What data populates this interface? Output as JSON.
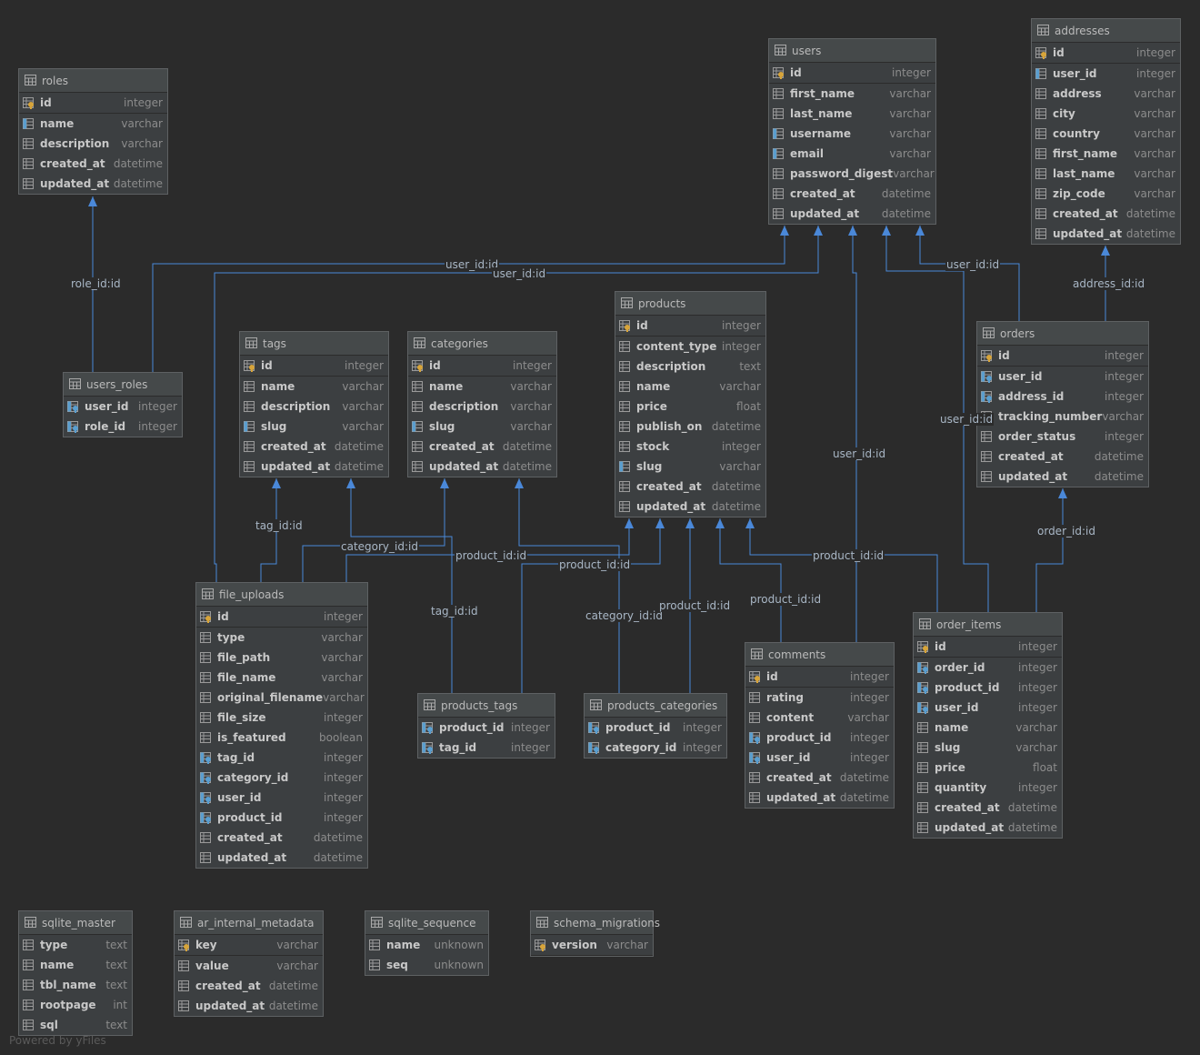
{
  "footer": "Powered by yFiles",
  "colors": {
    "background": "#2b2b2b",
    "table": "#3c3f41",
    "edge": "#4a88d8",
    "key": "#d7a43a",
    "fk": "#5a9ecf"
  },
  "tables": [
    {
      "id": "roles",
      "name": "roles",
      "columns": [
        {
          "name": "id",
          "type": "integer",
          "kind": "pk"
        },
        {
          "name": "name",
          "type": "varchar",
          "kind": "idx"
        },
        {
          "name": "description",
          "type": "varchar",
          "kind": "col"
        },
        {
          "name": "created_at",
          "type": "datetime",
          "kind": "col"
        },
        {
          "name": "updated_at",
          "type": "datetime",
          "kind": "col"
        }
      ]
    },
    {
      "id": "users",
      "name": "users",
      "columns": [
        {
          "name": "id",
          "type": "integer",
          "kind": "pk"
        },
        {
          "name": "first_name",
          "type": "varchar",
          "kind": "col"
        },
        {
          "name": "last_name",
          "type": "varchar",
          "kind": "col"
        },
        {
          "name": "username",
          "type": "varchar",
          "kind": "idx"
        },
        {
          "name": "email",
          "type": "varchar",
          "kind": "idx"
        },
        {
          "name": "password_digest",
          "type": "varchar",
          "kind": "col"
        },
        {
          "name": "created_at",
          "type": "datetime",
          "kind": "col"
        },
        {
          "name": "updated_at",
          "type": "datetime",
          "kind": "col"
        }
      ]
    },
    {
      "id": "addresses",
      "name": "addresses",
      "columns": [
        {
          "name": "id",
          "type": "integer",
          "kind": "pk"
        },
        {
          "name": "user_id",
          "type": "integer",
          "kind": "idx"
        },
        {
          "name": "address",
          "type": "varchar",
          "kind": "col"
        },
        {
          "name": "city",
          "type": "varchar",
          "kind": "col"
        },
        {
          "name": "country",
          "type": "varchar",
          "kind": "col"
        },
        {
          "name": "first_name",
          "type": "varchar",
          "kind": "col"
        },
        {
          "name": "last_name",
          "type": "varchar",
          "kind": "col"
        },
        {
          "name": "zip_code",
          "type": "varchar",
          "kind": "col"
        },
        {
          "name": "created_at",
          "type": "datetime",
          "kind": "col"
        },
        {
          "name": "updated_at",
          "type": "datetime",
          "kind": "col"
        }
      ]
    },
    {
      "id": "users_roles",
      "name": "users_roles",
      "columns": [
        {
          "name": "user_id",
          "type": "integer",
          "kind": "fk"
        },
        {
          "name": "role_id",
          "type": "integer",
          "kind": "fk"
        }
      ]
    },
    {
      "id": "tags",
      "name": "tags",
      "columns": [
        {
          "name": "id",
          "type": "integer",
          "kind": "pk"
        },
        {
          "name": "name",
          "type": "varchar",
          "kind": "col"
        },
        {
          "name": "description",
          "type": "varchar",
          "kind": "col"
        },
        {
          "name": "slug",
          "type": "varchar",
          "kind": "idx"
        },
        {
          "name": "created_at",
          "type": "datetime",
          "kind": "col"
        },
        {
          "name": "updated_at",
          "type": "datetime",
          "kind": "col"
        }
      ]
    },
    {
      "id": "categories",
      "name": "categories",
      "columns": [
        {
          "name": "id",
          "type": "integer",
          "kind": "pk"
        },
        {
          "name": "name",
          "type": "varchar",
          "kind": "col"
        },
        {
          "name": "description",
          "type": "varchar",
          "kind": "col"
        },
        {
          "name": "slug",
          "type": "varchar",
          "kind": "idx"
        },
        {
          "name": "created_at",
          "type": "datetime",
          "kind": "col"
        },
        {
          "name": "updated_at",
          "type": "datetime",
          "kind": "col"
        }
      ]
    },
    {
      "id": "products",
      "name": "products",
      "columns": [
        {
          "name": "id",
          "type": "integer",
          "kind": "pk"
        },
        {
          "name": "content_type",
          "type": "integer",
          "kind": "col"
        },
        {
          "name": "description",
          "type": "text",
          "kind": "col"
        },
        {
          "name": "name",
          "type": "varchar",
          "kind": "col"
        },
        {
          "name": "price",
          "type": "float",
          "kind": "col"
        },
        {
          "name": "publish_on",
          "type": "datetime",
          "kind": "col"
        },
        {
          "name": "stock",
          "type": "integer",
          "kind": "col"
        },
        {
          "name": "slug",
          "type": "varchar",
          "kind": "idx"
        },
        {
          "name": "created_at",
          "type": "datetime",
          "kind": "col"
        },
        {
          "name": "updated_at",
          "type": "datetime",
          "kind": "col"
        }
      ]
    },
    {
      "id": "orders",
      "name": "orders",
      "columns": [
        {
          "name": "id",
          "type": "integer",
          "kind": "pk"
        },
        {
          "name": "user_id",
          "type": "integer",
          "kind": "fk"
        },
        {
          "name": "address_id",
          "type": "integer",
          "kind": "fk"
        },
        {
          "name": "tracking_number",
          "type": "varchar",
          "kind": "col"
        },
        {
          "name": "order_status",
          "type": "integer",
          "kind": "col"
        },
        {
          "name": "created_at",
          "type": "datetime",
          "kind": "col"
        },
        {
          "name": "updated_at",
          "type": "datetime",
          "kind": "col"
        }
      ]
    },
    {
      "id": "file_uploads",
      "name": "file_uploads",
      "columns": [
        {
          "name": "id",
          "type": "integer",
          "kind": "pk"
        },
        {
          "name": "type",
          "type": "varchar",
          "kind": "col"
        },
        {
          "name": "file_path",
          "type": "varchar",
          "kind": "col"
        },
        {
          "name": "file_name",
          "type": "varchar",
          "kind": "col"
        },
        {
          "name": "original_filename",
          "type": "varchar",
          "kind": "col"
        },
        {
          "name": "file_size",
          "type": "integer",
          "kind": "col"
        },
        {
          "name": "is_featured",
          "type": "boolean",
          "kind": "col"
        },
        {
          "name": "tag_id",
          "type": "integer",
          "kind": "fk"
        },
        {
          "name": "category_id",
          "type": "integer",
          "kind": "fk"
        },
        {
          "name": "user_id",
          "type": "integer",
          "kind": "fk"
        },
        {
          "name": "product_id",
          "type": "integer",
          "kind": "fk"
        },
        {
          "name": "created_at",
          "type": "datetime",
          "kind": "col"
        },
        {
          "name": "updated_at",
          "type": "datetime",
          "kind": "col"
        }
      ]
    },
    {
      "id": "products_tags",
      "name": "products_tags",
      "columns": [
        {
          "name": "product_id",
          "type": "integer",
          "kind": "fk"
        },
        {
          "name": "tag_id",
          "type": "integer",
          "kind": "fk"
        }
      ]
    },
    {
      "id": "products_categories",
      "name": "products_categories",
      "columns": [
        {
          "name": "product_id",
          "type": "integer",
          "kind": "fk"
        },
        {
          "name": "category_id",
          "type": "integer",
          "kind": "fk"
        }
      ]
    },
    {
      "id": "comments",
      "name": "comments",
      "columns": [
        {
          "name": "id",
          "type": "integer",
          "kind": "pk"
        },
        {
          "name": "rating",
          "type": "integer",
          "kind": "col"
        },
        {
          "name": "content",
          "type": "varchar",
          "kind": "col"
        },
        {
          "name": "product_id",
          "type": "integer",
          "kind": "fk"
        },
        {
          "name": "user_id",
          "type": "integer",
          "kind": "fk"
        },
        {
          "name": "created_at",
          "type": "datetime",
          "kind": "col"
        },
        {
          "name": "updated_at",
          "type": "datetime",
          "kind": "col"
        }
      ]
    },
    {
      "id": "order_items",
      "name": "order_items",
      "columns": [
        {
          "name": "id",
          "type": "integer",
          "kind": "pk"
        },
        {
          "name": "order_id",
          "type": "integer",
          "kind": "fk"
        },
        {
          "name": "product_id",
          "type": "integer",
          "kind": "fk"
        },
        {
          "name": "user_id",
          "type": "integer",
          "kind": "fk"
        },
        {
          "name": "name",
          "type": "varchar",
          "kind": "col"
        },
        {
          "name": "slug",
          "type": "varchar",
          "kind": "col"
        },
        {
          "name": "price",
          "type": "float",
          "kind": "col"
        },
        {
          "name": "quantity",
          "type": "integer",
          "kind": "col"
        },
        {
          "name": "created_at",
          "type": "datetime",
          "kind": "col"
        },
        {
          "name": "updated_at",
          "type": "datetime",
          "kind": "col"
        }
      ]
    },
    {
      "id": "sqlite_master",
      "name": "sqlite_master",
      "columns": [
        {
          "name": "type",
          "type": "text",
          "kind": "col"
        },
        {
          "name": "name",
          "type": "text",
          "kind": "col"
        },
        {
          "name": "tbl_name",
          "type": "text",
          "kind": "col"
        },
        {
          "name": "rootpage",
          "type": "int",
          "kind": "col"
        },
        {
          "name": "sql",
          "type": "text",
          "kind": "col"
        }
      ]
    },
    {
      "id": "ar_internal_metadata",
      "name": "ar_internal_metadata",
      "columns": [
        {
          "name": "key",
          "type": "varchar",
          "kind": "pk"
        },
        {
          "name": "value",
          "type": "varchar",
          "kind": "col"
        },
        {
          "name": "created_at",
          "type": "datetime",
          "kind": "col"
        },
        {
          "name": "updated_at",
          "type": "datetime",
          "kind": "col"
        }
      ]
    },
    {
      "id": "sqlite_sequence",
      "name": "sqlite_sequence",
      "columns": [
        {
          "name": "name",
          "type": "unknown",
          "kind": "col"
        },
        {
          "name": "seq",
          "type": "unknown",
          "kind": "col"
        }
      ]
    },
    {
      "id": "schema_migrations",
      "name": "schema_migrations",
      "columns": [
        {
          "name": "version",
          "type": "varchar",
          "kind": "pk"
        }
      ]
    }
  ],
  "relations": [
    {
      "id": "users_roles-roles",
      "label": "role_id:id"
    },
    {
      "id": "users_roles-users",
      "label": "user_id:id"
    },
    {
      "id": "file_uploads-users",
      "label": "user_id:id"
    },
    {
      "id": "comments-users",
      "label": "user_id:id"
    },
    {
      "id": "order_items-users",
      "label": "user_id:id"
    },
    {
      "id": "orders-users",
      "label": "user_id:id"
    },
    {
      "id": "orders-addresses",
      "label": "address_id:id"
    },
    {
      "id": "file_uploads-tags",
      "label": "tag_id:id"
    },
    {
      "id": "file_uploads-categories",
      "label": "category_id:id"
    },
    {
      "id": "products_tags-tags",
      "label": "tag_id:id"
    },
    {
      "id": "products_categories-categories",
      "label": "category_id:id"
    },
    {
      "id": "file_uploads-products",
      "label": "product_id:id"
    },
    {
      "id": "products_tags-products",
      "label": "product_id:id"
    },
    {
      "id": "products_categories-products",
      "label": "product_id:id"
    },
    {
      "id": "comments-products",
      "label": "product_id:id"
    },
    {
      "id": "order_items-products",
      "label": "product_id:id"
    },
    {
      "id": "order_items-orders",
      "label": "order_id:id"
    }
  ]
}
